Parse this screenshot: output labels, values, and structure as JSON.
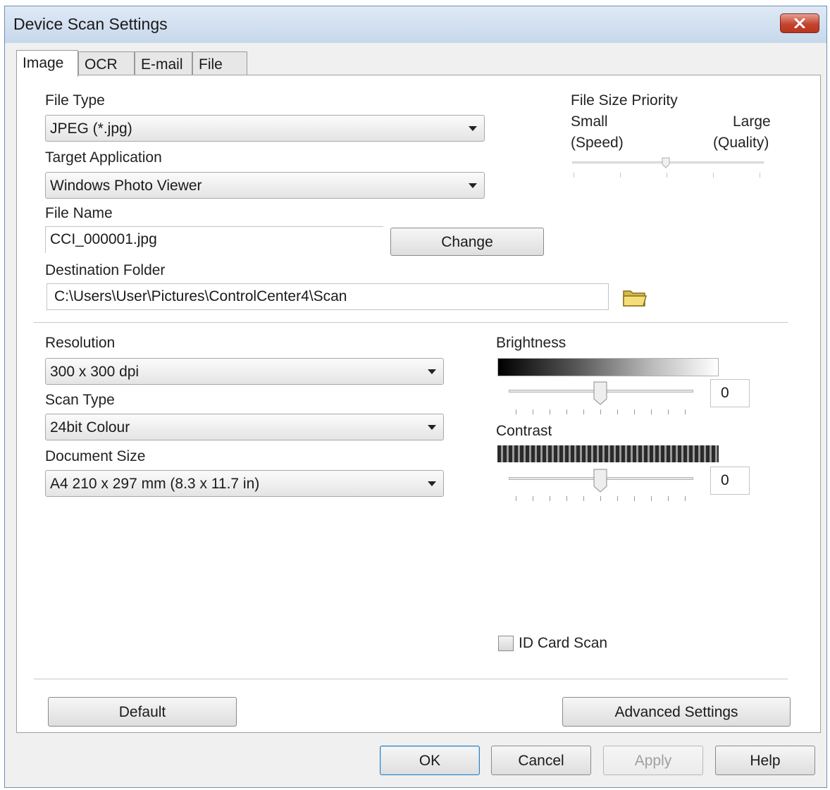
{
  "window": {
    "title": "Device Scan Settings"
  },
  "tabs": [
    {
      "label": "Image",
      "active": true
    },
    {
      "label": "OCR"
    },
    {
      "label": "E-mail"
    },
    {
      "label": "File"
    }
  ],
  "file_type": {
    "label": "File Type",
    "value": "JPEG (*.jpg)"
  },
  "target_application": {
    "label": "Target Application",
    "value": "Windows Photo Viewer"
  },
  "file_name": {
    "label": "File Name",
    "value": "CCI_000001.jpg",
    "change_button": "Change"
  },
  "destination_folder": {
    "label": "Destination Folder",
    "value": "C:\\Users\\User\\Pictures\\ControlCenter4\\Scan"
  },
  "file_size_priority": {
    "label": "File Size Priority",
    "small": "Small",
    "small_sub": "(Speed)",
    "large": "Large",
    "large_sub": "(Quality)",
    "level": 0.5
  },
  "resolution": {
    "label": "Resolution",
    "value": "300 x 300 dpi"
  },
  "scan_type": {
    "label": "Scan Type",
    "value": "24bit Colour"
  },
  "document_size": {
    "label": "Document Size",
    "value": "A4 210 x 297 mm (8.3 x 11.7 in)"
  },
  "brightness": {
    "label": "Brightness",
    "value": "0",
    "level": 0.5
  },
  "contrast": {
    "label": "Contrast",
    "value": "0",
    "level": 0.5
  },
  "id_card_scan": {
    "label": "ID Card Scan",
    "checked": false
  },
  "buttons": {
    "default": "Default",
    "advanced": "Advanced Settings",
    "ok": "OK",
    "cancel": "Cancel",
    "apply": "Apply",
    "help": "Help"
  },
  "colors": {
    "title_bar": "#c7d8ec",
    "close_button": "#c4442f",
    "dialog_bg": "#f0f0f0"
  }
}
